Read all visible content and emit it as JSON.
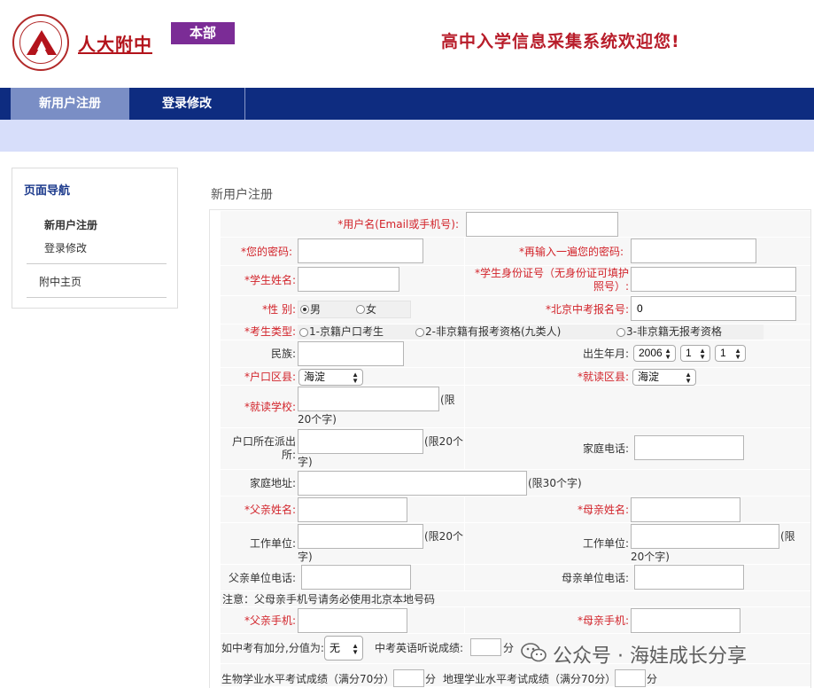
{
  "header": {
    "logo_name": "人大附中",
    "badge": "本部",
    "welcome": "高中入学信息采集系统欢迎您!"
  },
  "nav": {
    "tabs": [
      "新用户注册",
      "登录修改"
    ]
  },
  "sidebar": {
    "title": "页面导航",
    "items": [
      "新用户注册",
      "登录修改",
      "附中主页"
    ]
  },
  "form": {
    "title": "新用户注册",
    "labels": {
      "username": "*用户名(Email或手机号):",
      "password": "*您的密码:",
      "password2": "*再输入一遍您的密码:",
      "student_name": "*学生姓名:",
      "id_number": "*学生身份证号（无身份证可填护照号）:",
      "gender": "*性 别:",
      "exam_number": "*北京中考报名号:",
      "candidate_type": "*考生类型:",
      "ethnicity": "民族:",
      "birth": "出生年月:",
      "hukou_district": "*户口区县:",
      "school_district": "*就读区县:",
      "school": "*就读学校:",
      "police_station": "户口所在派出所:",
      "home_phone": "家庭电话:",
      "address": "家庭地址:",
      "father_name": "*父亲姓名:",
      "mother_name": "*母亲姓名:",
      "father_work": "工作单位:",
      "mother_work": "工作单位:",
      "father_work_phone": "父亲单位电话:",
      "mother_work_phone": "母亲单位电话:",
      "notice": "注意：父母亲手机号请务必使用北京本地号码",
      "father_mobile": "*父亲手机:",
      "mother_mobile": "*母亲手机:",
      "bonus": "如中考有加分,分值为:",
      "english_listening": "中考英语听说成绩:",
      "biology": "生物学业水平考试成绩（满分70分）",
      "geography": "地理学业水平考试成绩（满分70分）",
      "unit_score": "分"
    },
    "values": {
      "exam_number": "0",
      "hukou_district": "海淀",
      "school_district": "海淀",
      "birth_year": "2006",
      "birth_month": "1",
      "birth_day": "1",
      "bonus": "无"
    },
    "gender_options": [
      "男",
      "女"
    ],
    "gender_selected": "男",
    "candidate_types": [
      "1-京籍户口考生",
      "2-非京籍有报考资格(九类人)",
      "3-非京籍无报考资格"
    ],
    "limits": {
      "limit20_a": "(限",
      "limit20_b": "20个字)",
      "limit20_c": "(限20个",
      "limit20_d": "字)",
      "limit30": "(限30个字)"
    }
  },
  "watermark": "公众号 · 海娃成长分享"
}
